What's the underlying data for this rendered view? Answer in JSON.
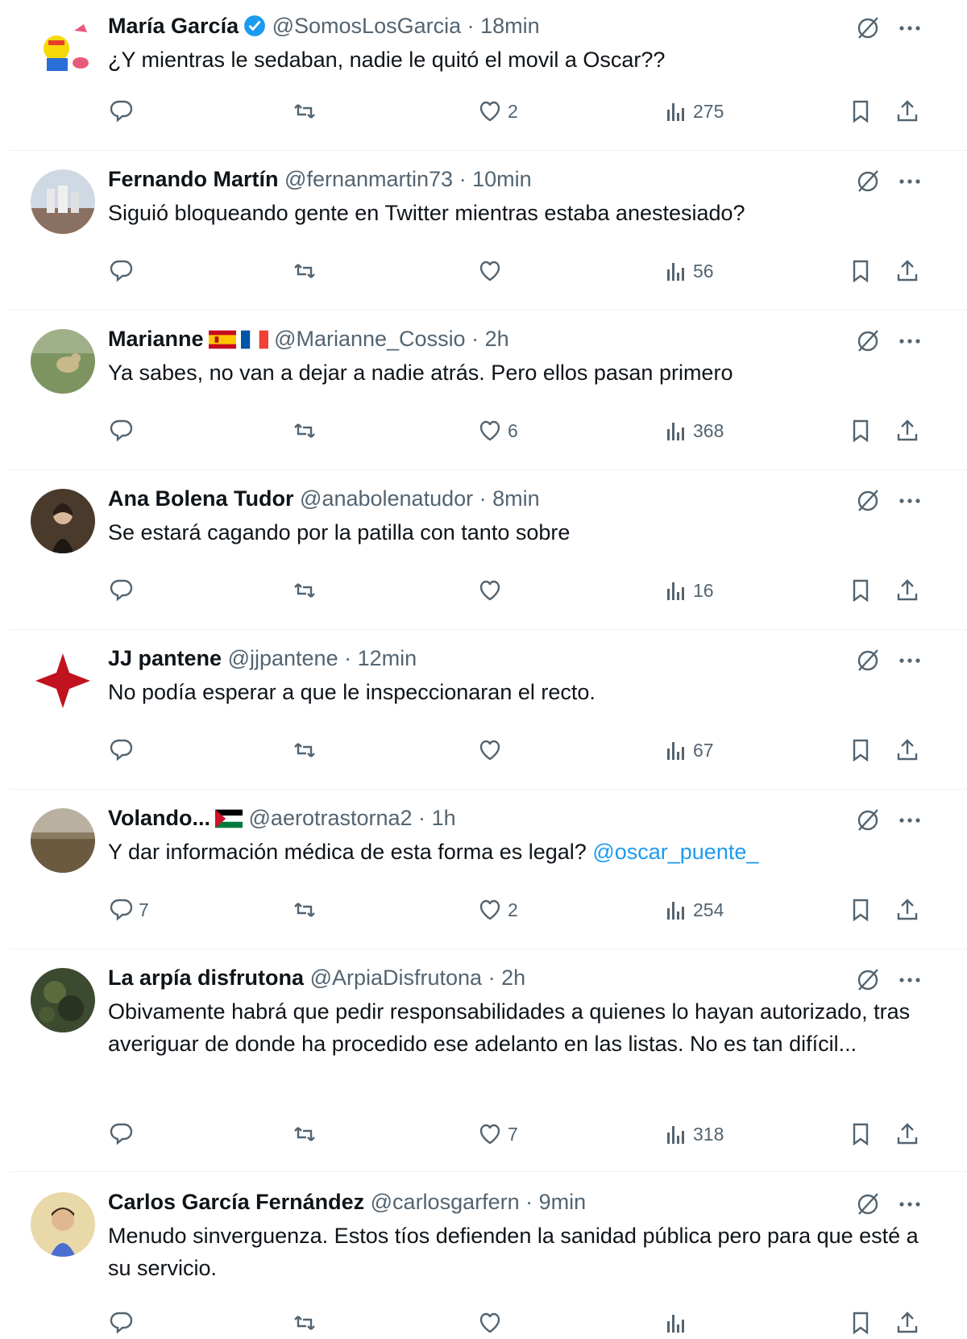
{
  "colors": {
    "text": "#0f1419",
    "muted": "#536471",
    "link": "#1d9bf0",
    "verified": "#1d9bf0",
    "divider": "#eff3f4"
  },
  "tweets": [
    {
      "name": "María García",
      "verified": true,
      "flags": [],
      "handle": "@SomosLosGarcia",
      "sep": "·",
      "time": "18min",
      "text": "¿Y mientras le sedaban, nadie le quitó el movil a Oscar??",
      "mention": "",
      "replies": "",
      "likes": "2",
      "views": "275",
      "avatar": "cartoon"
    },
    {
      "name": "Fernando Martín",
      "verified": false,
      "flags": [],
      "handle": "@fernanmartin73",
      "sep": "·",
      "time": "10min",
      "text": "Siguió bloqueando gente en Twitter mientras estaba anestesiado?",
      "mention": "",
      "replies": "",
      "likes": "",
      "views": "56",
      "avatar": "sky"
    },
    {
      "name": "Marianne",
      "verified": false,
      "flags": [
        "es-flag",
        "fr-flag"
      ],
      "handle": "@Marianne_Cossio",
      "sep": "·",
      "time": "2h",
      "text": "Ya sabes, no van a dejar a nadie atrás. Pero ellos pasan primero",
      "mention": "",
      "replies": "",
      "likes": "6",
      "views": "368",
      "avatar": "field"
    },
    {
      "name": "Ana Bolena Tudor",
      "verified": false,
      "flags": [],
      "handle": "@anabolenatudor",
      "sep": "·",
      "time": "8min",
      "text": "Se estará cagando por la patilla con tanto sobre",
      "mention": "",
      "replies": "",
      "likes": "",
      "views": "16",
      "avatar": "portrait"
    },
    {
      "name": "JJ pantene",
      "verified": false,
      "flags": [],
      "handle": "@jjpantene",
      "sep": "·",
      "time": "12min",
      "text": "No podía esperar a que le inspeccionaran el recto.",
      "mention": "",
      "replies": "",
      "likes": "",
      "views": "67",
      "avatar": "cross"
    },
    {
      "name": "Volando...",
      "verified": false,
      "flags": [
        "ps-flag"
      ],
      "handle": "@aerotrastorna2",
      "sep": "·",
      "time": "1h",
      "text": "Y dar información médica de esta forma es legal? ",
      "mention": "@oscar_puente_",
      "replies": "7",
      "likes": "2",
      "views": "254",
      "avatar": "landscape"
    },
    {
      "name": "La arpía disfrutona",
      "verified": false,
      "flags": [],
      "handle": "@ArpiaDisfrutona",
      "sep": "·",
      "time": "2h",
      "text": "Obivamente habrá que pedir responsabilidades a quienes lo hayan autorizado, tras averiguar de donde ha procedido ese adelanto en las listas. No es tan difícil...",
      "mention": "",
      "replies": "",
      "likes": "7",
      "views": "318",
      "avatar": "forest"
    },
    {
      "name": "Carlos García Fernández",
      "verified": false,
      "flags": [],
      "handle": "@carlosgarfern",
      "sep": "·",
      "time": "9min",
      "text": "Menudo sinverguenza. Estos tíos defienden la sanidad pública pero para que esté a su servicio.",
      "mention": "",
      "replies": "",
      "likes": "",
      "views": "",
      "avatar": "child"
    }
  ]
}
